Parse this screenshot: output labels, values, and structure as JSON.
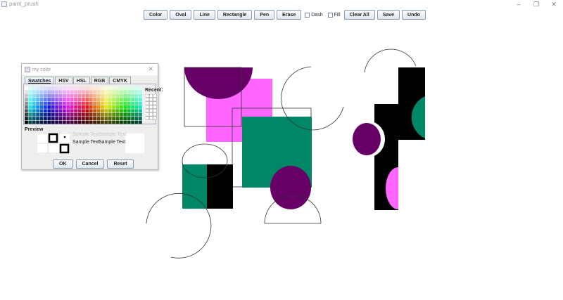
{
  "window": {
    "title": "paint_prush",
    "minimize": "–",
    "maximize": "❐",
    "close": "✕"
  },
  "toolbar": {
    "color": "Color",
    "oval": "Oval",
    "line": "Line",
    "rectangle": "Rectangle",
    "pen": "Pen",
    "erase": "Erase",
    "dash": "Dash",
    "fill": "Fill",
    "clear_all": "Clear All",
    "save": "Save",
    "undo": "Undo"
  },
  "colors": {
    "purple": "#660066",
    "pink": "#ff66ff",
    "green": "#008866",
    "black": "#000000"
  },
  "dialog": {
    "title": "my color",
    "close": "✕",
    "tabs": [
      "Swatches",
      "HSV",
      "HSL",
      "RGB",
      "CMYK"
    ],
    "recent_label": "Recent:",
    "preview_label": "Preview",
    "sample_text": "Sample Text",
    "ok": "OK",
    "cancel": "Cancel",
    "reset": "Reset"
  }
}
